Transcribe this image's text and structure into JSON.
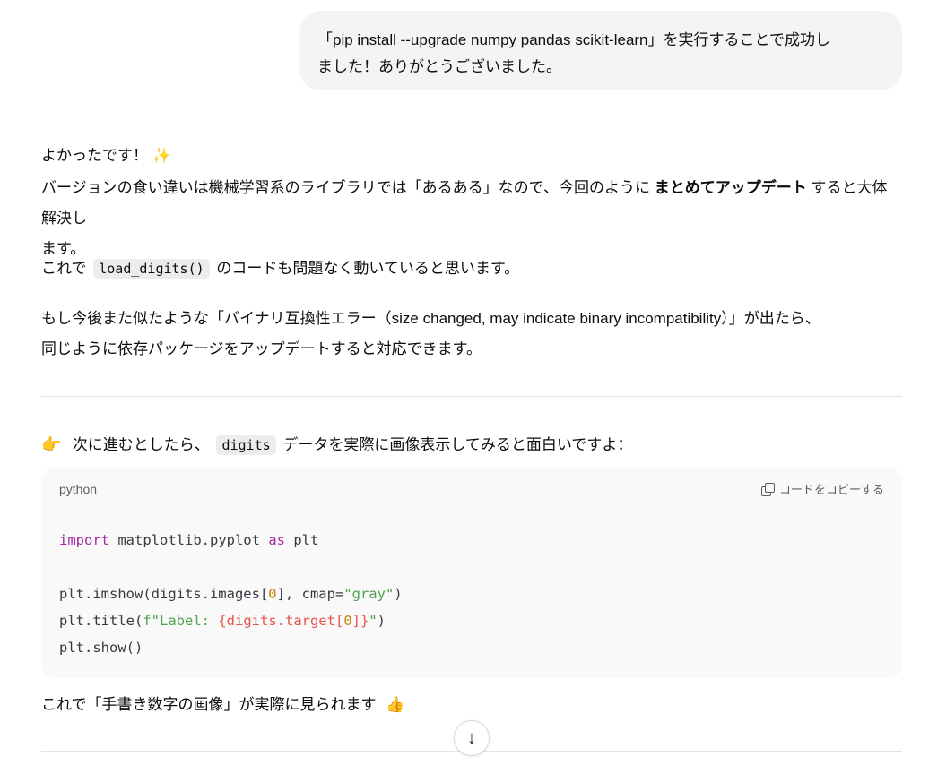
{
  "user_message": {
    "line1": "「pip install --upgrade numpy pandas scikit-learn」を実行することで成功し",
    "line2": "ました！ありがとうございました。"
  },
  "assistant": {
    "greeting": "よかったです！",
    "sparkle": "✨",
    "p1_before": "バージョンの食い違いは機械学習系のライブラリでは「あるある」なので、今回のように",
    "p1_bold": "まとめてアップデート",
    "p1_after": "すると大体解決し",
    "p1_line2": "ます。",
    "p2_before": "これで",
    "p2_code": "load_digits()",
    "p2_after": "のコードも問題なく動いていると思います。",
    "p3_line1": "もし今後また似たような「バイナリ互換性エラー（size changed, may indicate binary incompatibility）」が出たら、",
    "p3_line2": "同じように依存パッケージをアップデートすると対応できます。",
    "next_before": "次に進むとしたら、",
    "next_code": "digits",
    "next_after": "データを実際に画像表示してみると面白いですよ：",
    "pointing_emoji": "👉",
    "closing_text": "これで「手書き数字の画像」が実際に見られます",
    "thumbs_emoji": "👍"
  },
  "code_block": {
    "language": "python",
    "copy_label": "コードをコピーする",
    "line1_kw1": "import",
    "line1_mid": " matplotlib.pyplot ",
    "line1_kw2": "as",
    "line1_end": " plt",
    "line3_a": "plt.imshow(digits.images[",
    "line3_num": "0",
    "line3_b": "], cmap=",
    "line3_str": "\"gray\"",
    "line3_c": ")",
    "line4_a": "plt.title(",
    "line4_str1": "f\"Label: ",
    "line4_interp1": "{digits.target[",
    "line4_num": "0",
    "line4_interp2": "]}",
    "line4_str2": "\"",
    "line4_c": ")",
    "line5": "plt.show()"
  },
  "scroll_down_icon": "↓"
}
